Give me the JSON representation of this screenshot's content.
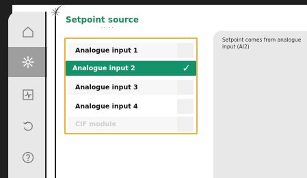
{
  "header": {
    "title": "Setpoint source",
    "subtitle": "· · · · ·"
  },
  "sidebar": {
    "items": [
      {
        "icon": "home-icon",
        "active": false
      },
      {
        "icon": "gear-icon",
        "active": true
      },
      {
        "icon": "diagnostics-icon",
        "active": false
      },
      {
        "icon": "restore-icon",
        "active": false
      },
      {
        "icon": "help-icon",
        "active": false
      }
    ]
  },
  "list": {
    "items": [
      {
        "label": "Analogue input 1",
        "state": "normal"
      },
      {
        "label": "Analogue input 2",
        "state": "selected"
      },
      {
        "label": "Analogue input 3",
        "state": "normal"
      },
      {
        "label": "Analogue input 4",
        "state": "normal"
      },
      {
        "label": "CIF module",
        "state": "disabled"
      }
    ],
    "check_mark": "✓"
  },
  "help": {
    "text": "Setpoint comes from analogue input (AI2)"
  },
  "colors": {
    "accent_green": "#14926a",
    "title_green": "#1a8a5a",
    "focus_border": "#f2b233",
    "sidebar_bg": "#e8e8e8",
    "active_item": "#9e9e9e",
    "frame_dark": "#1f1f1f"
  }
}
